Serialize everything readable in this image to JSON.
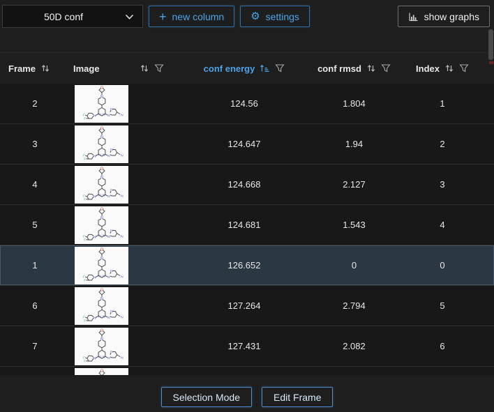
{
  "toolbar": {
    "dataset_select": {
      "value": "50D conf"
    },
    "new_column_label": "new column",
    "settings_label": "settings",
    "show_graphs_label": "show graphs"
  },
  "table": {
    "columns": {
      "frame": "Frame",
      "image": "Image",
      "conf_energy": "conf energy",
      "conf_rmsd": "conf rmsd",
      "index": "Index"
    },
    "sorted_column": "conf energy",
    "sort_direction": "ascending",
    "rows": [
      {
        "frame": "2",
        "conf_energy": "124.56",
        "conf_rmsd": "1.804",
        "index": "1",
        "selected": false
      },
      {
        "frame": "3",
        "conf_energy": "124.647",
        "conf_rmsd": "1.94",
        "index": "2",
        "selected": false
      },
      {
        "frame": "4",
        "conf_energy": "124.668",
        "conf_rmsd": "2.127",
        "index": "3",
        "selected": false
      },
      {
        "frame": "5",
        "conf_energy": "124.681",
        "conf_rmsd": "1.543",
        "index": "4",
        "selected": false
      },
      {
        "frame": "1",
        "conf_energy": "126.652",
        "conf_rmsd": "0",
        "index": "0",
        "selected": true
      },
      {
        "frame": "6",
        "conf_energy": "127.264",
        "conf_rmsd": "2.794",
        "index": "5",
        "selected": false
      },
      {
        "frame": "7",
        "conf_energy": "127.431",
        "conf_rmsd": "2.082",
        "index": "6",
        "selected": false
      },
      {
        "frame": "",
        "conf_energy": "",
        "conf_rmsd": "",
        "index": "",
        "selected": false
      }
    ]
  },
  "footer": {
    "selection_mode_label": "Selection Mode",
    "edit_frame_label": "Edit Frame"
  },
  "icons": {
    "dropdown": "chevron-down",
    "new_column": "plus",
    "settings": "gear",
    "show_graphs": "bar-chart",
    "sortable": "sort-arrows",
    "active_sort": "sort-ascending",
    "filter": "funnel"
  },
  "colors": {
    "accent": "#4da3e8",
    "selected_row_bg": "#2b3742",
    "background": "#1e1e1e"
  }
}
